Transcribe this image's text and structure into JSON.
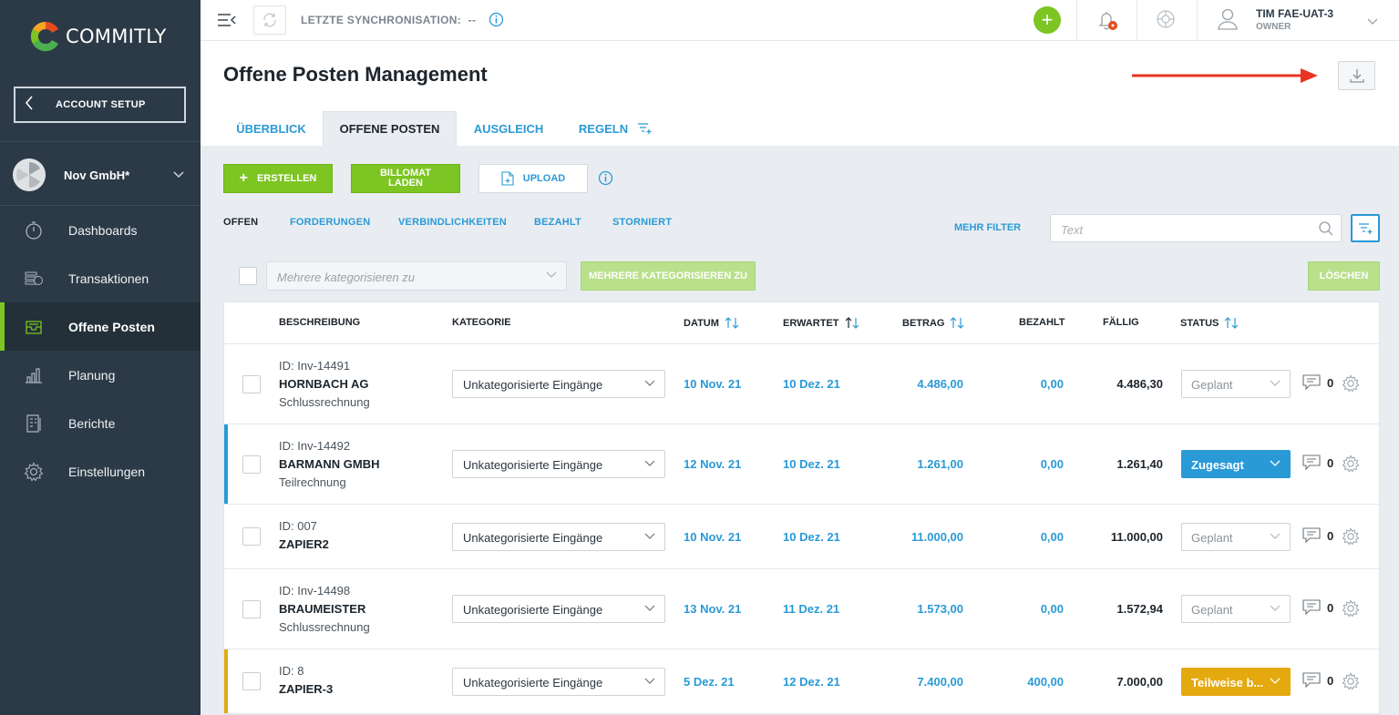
{
  "app": {
    "logo_text": "COMMITLY"
  },
  "sidebar": {
    "account_setup": "ACCOUNT SETUP",
    "company": "Nov GmbH*",
    "items": [
      {
        "label": "Dashboards",
        "icon": "stopwatch-icon",
        "active": false
      },
      {
        "label": "Transaktionen",
        "icon": "coins-icon",
        "active": false
      },
      {
        "label": "Offene Posten",
        "icon": "inbox-icon",
        "active": true
      },
      {
        "label": "Planung",
        "icon": "bar-chart-icon",
        "active": false
      },
      {
        "label": "Berichte",
        "icon": "report-icon",
        "active": false
      },
      {
        "label": "Einstellungen",
        "icon": "gear-icon",
        "active": false
      }
    ]
  },
  "topbar": {
    "sync_label": "LETZTE SYNCHRONISATION:",
    "sync_value": "--",
    "user_name": "TIM FAE-UAT-3",
    "user_role": "OWNER"
  },
  "page": {
    "title": "Offene Posten Management",
    "tabs": [
      "ÜBERBLICK",
      "OFFENE POSTEN",
      "AUSGLEICH",
      "REGELN"
    ],
    "active_tab": "OFFENE POSTEN"
  },
  "actions": {
    "create": "ERSTELLEN",
    "billomat_1": "BILLOMAT",
    "billomat_2": "LADEN",
    "upload": "UPLOAD"
  },
  "filters": {
    "subtabs": [
      "OFFEN",
      "FORDERUNGEN",
      "VERBINDLICHKEITEN",
      "BEZAHLT",
      "STORNIERT"
    ],
    "active_subtab": "OFFEN",
    "more": "MEHR FILTER",
    "search_placeholder": "Text"
  },
  "bulk": {
    "placeholder": "Mehrere kategorisieren zu",
    "categorize": "MEHRERE KATEGORISIEREN ZU",
    "delete": "LÖSCHEN"
  },
  "table": {
    "columns": {
      "description": "BESCHREIBUNG",
      "category": "KATEGORIE",
      "date": "DATUM",
      "expected": "ERWARTET",
      "amount": "BETRAG",
      "paid": "BEZAHLT",
      "due": "FÄLLIG",
      "status": "STATUS"
    },
    "rows": [
      {
        "id": "ID: Inv-14491",
        "name": "HORNBACH AG",
        "sub": "Schlussrechnung",
        "category": "Unkategorisierte Eingänge",
        "date": "10 Nov. 21",
        "expected": "10 Dez. 21",
        "amount": "4.486,00",
        "paid": "0,00",
        "due": "4.486,30",
        "status": "Geplant",
        "status_style": "plain",
        "comments": "0",
        "accent": ""
      },
      {
        "id": "ID: Inv-14492",
        "name": "BARMANN GMBH",
        "sub": "Teilrechnung",
        "category": "Unkategorisierte Eingänge",
        "date": "12 Nov. 21",
        "expected": "10 Dez. 21",
        "amount": "1.261,00",
        "paid": "0,00",
        "due": "1.261,40",
        "status": "Zugesagt",
        "status_style": "blue",
        "comments": "0",
        "accent": "#2a9ad6"
      },
      {
        "id": "ID: 007",
        "name": "ZAPIER2",
        "sub": "",
        "category": "Unkategorisierte Eingänge",
        "date": "10 Nov. 21",
        "expected": "10 Dez. 21",
        "amount": "11.000,00",
        "paid": "0,00",
        "due": "11.000,00",
        "status": "Geplant",
        "status_style": "plain",
        "comments": "0",
        "accent": ""
      },
      {
        "id": "ID: Inv-14498",
        "name": "BRAUMEISTER",
        "sub": "Schlussrechnung",
        "category": "Unkategorisierte Eingänge",
        "date": "13 Nov. 21",
        "expected": "11 Dez. 21",
        "amount": "1.573,00",
        "paid": "0,00",
        "due": "1.572,94",
        "status": "Geplant",
        "status_style": "plain",
        "comments": "0",
        "accent": ""
      },
      {
        "id": "ID: 8",
        "name": "ZAPIER-3",
        "sub": "",
        "category": "Unkategorisierte Eingänge",
        "date": "5 Dez. 21",
        "expected": "12 Dez. 21",
        "amount": "7.400,00",
        "paid": "400,00",
        "due": "7.000,00",
        "status": "Teilweise b...",
        "status_style": "yellow",
        "comments": "0",
        "accent": "#e3a90f"
      }
    ]
  },
  "colors": {
    "accent_green": "#7cc522",
    "link_blue": "#2a9ad6",
    "sidebar": "#2c3a47",
    "warning": "#e3a90f"
  }
}
